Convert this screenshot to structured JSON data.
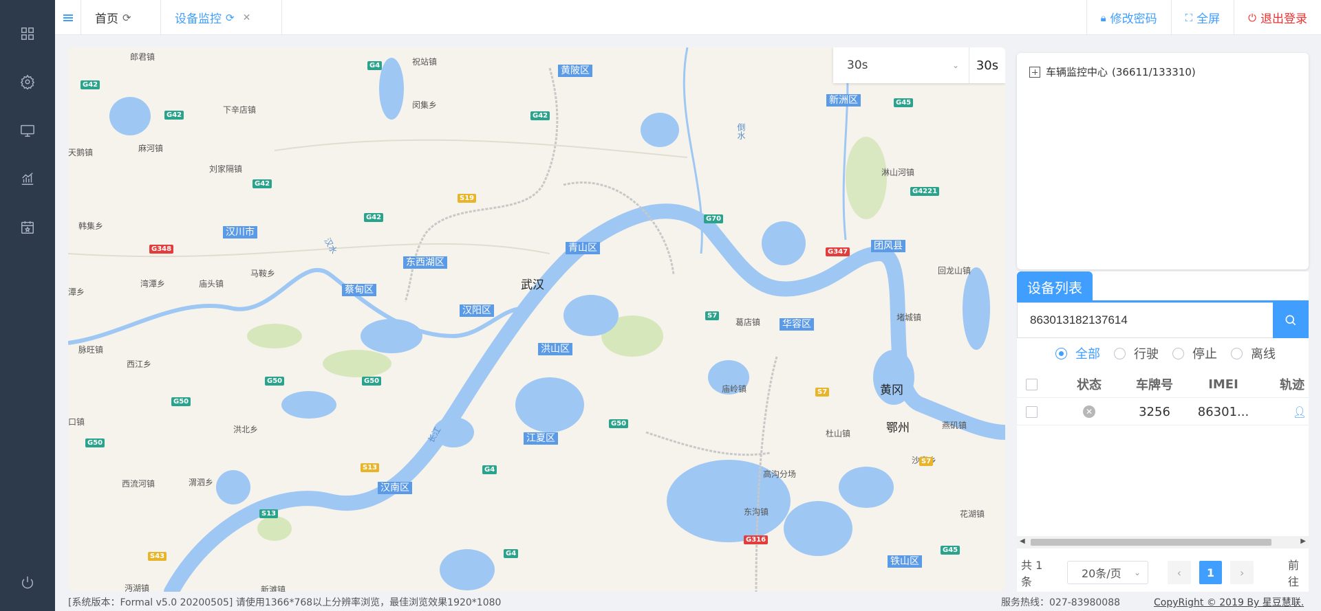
{
  "sidebar": {
    "items": [
      {
        "icon": "dashboard-icon"
      },
      {
        "icon": "settings-icon"
      },
      {
        "icon": "monitor-icon"
      },
      {
        "icon": "chart-icon"
      },
      {
        "icon": "calendar-icon"
      },
      {
        "icon": "power-icon"
      }
    ]
  },
  "tabs": [
    {
      "label": "首页",
      "active": false
    },
    {
      "label": "设备监控",
      "active": true
    }
  ],
  "top_actions": {
    "change_password": "修改密码",
    "fullscreen": "全屏",
    "logout": "退出登录"
  },
  "map": {
    "refresh_select": "30s",
    "refresh_count": "30s",
    "places": [
      "郎君镇",
      "祝站镇",
      "闵集乡",
      "下辛店镇",
      "天鹅镇",
      "麻河镇",
      "刘家隔镇",
      "韩集乡",
      "马鞍乡",
      "庙头镇",
      "湾潭乡",
      "潭乡",
      "脉旺镇",
      "西江乡",
      "洪北乡",
      "西流河镇",
      "渭泗乡",
      "沔湖镇",
      "新滩镇",
      "淋山河镇",
      "回龙山镇",
      "堵城镇",
      "葛店镇",
      "庙岭镇",
      "杜山镇",
      "燕矶镇",
      "沙窝乡",
      "高沟分场",
      "东沟镇",
      "花湖镇",
      "口镇"
    ],
    "city": "武汉",
    "city2": "黄冈",
    "city3": "鄂州",
    "districts": [
      "黄陂区",
      "新洲区",
      "汉川市",
      "东西湖区",
      "青山区",
      "团风县",
      "蔡甸区",
      "汉阳区",
      "华容区",
      "洪山区",
      "江夏区",
      "汉南区",
      "铁山区"
    ],
    "river_labels": [
      "汉水",
      "倒水",
      "长江"
    ],
    "shields": [
      "G42",
      "G4",
      "G42",
      "G42",
      "G42",
      "G45",
      "S19",
      "G42",
      "G70",
      "G4221",
      "G348",
      "G347",
      "S7",
      "G50",
      "G50",
      "G50",
      "G50",
      "S7",
      "G50",
      "S13",
      "G4",
      "S13",
      "S43",
      "G316",
      "G45",
      "S7",
      "G4"
    ]
  },
  "tree": {
    "root_label": "车辆监控中心",
    "root_count": "(36611/133310)"
  },
  "device_list": {
    "tab_label": "设备列表",
    "search_value": "863013182137614",
    "filters": [
      {
        "label": "全部",
        "selected": true
      },
      {
        "label": "行驶",
        "selected": false
      },
      {
        "label": "停止",
        "selected": false
      },
      {
        "label": "离线",
        "selected": false
      }
    ],
    "columns": [
      "状态",
      "车牌号",
      "IMEI",
      "轨迹"
    ],
    "rows": [
      {
        "status": "offline",
        "plate": "3256",
        "imei": "86301..."
      }
    ],
    "pagination": {
      "total": "共 1 条",
      "page_size": "20条/页",
      "current_page": "1",
      "goto": "前往"
    }
  },
  "footer": {
    "version": "[系统版本：Formal v5.0 20200505] 请使用1366*768以上分辨率浏览，最佳浏览效果1920*1080",
    "hotline": "服务热线：027-83980088",
    "copyright": "CopyRight © 2019 By 星豆慧联."
  }
}
